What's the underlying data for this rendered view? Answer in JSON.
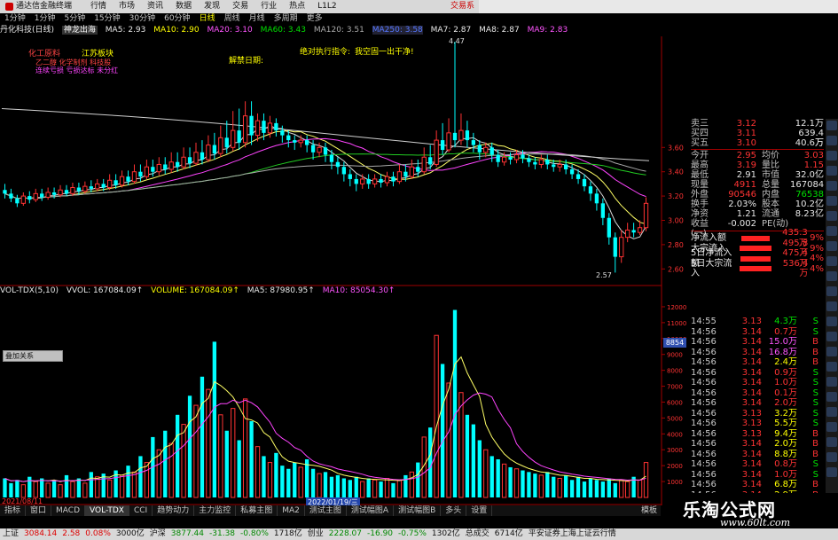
{
  "menubar": {
    "app_title": "通达信金融终端",
    "items": [
      "行情",
      "市场",
      "资讯",
      "数据",
      "发现",
      "交易",
      "行业",
      "热点",
      "L1L2"
    ],
    "trade_label": "交易系"
  },
  "toolbar": {
    "items": [
      "1分钟",
      "1分钟",
      "5分钟",
      "15分钟",
      "30分钟",
      "60分钟",
      "日线",
      "周线",
      "月线",
      "多周期",
      "更多"
    ],
    "active_index": 6
  },
  "ma_header": {
    "stock": "丹化科技(日线)",
    "indicator": "神龙出海",
    "ma5": "MA5: 2.93",
    "ma10": "MA10: 2.90",
    "ma20": "MA20: 3.10",
    "ma60": "MA60: 3.43",
    "ma120": "MA120: 3.51",
    "ma250": "MA250: 3.58",
    "ma7": "MA7: 2.87",
    "ma8": "MA8: 2.87",
    "ma9": "MA9: 2.83"
  },
  "annotations": {
    "a1": "化工原料",
    "a2": "江苏板块",
    "a3": "乙二醇 化学制剂 科技股",
    "a4": "连续亏损 亏损达标 未分红",
    "a5": "解禁日期:",
    "a6": "绝对执行指令:",
    "a7": "我空固一出干净!",
    "high_label": "4.47",
    "low_label": "2.57"
  },
  "colors": {
    "up": "#ff3333",
    "down": "#00ffff",
    "doji": "#ffff00",
    "ma_white": "#d8d8d8",
    "ma_yellow": "#ffff66",
    "ma_magenta": "#ff44ff",
    "ma_green": "#22cc22",
    "ma_gray": "#aaaaaa"
  },
  "price_axis": {
    "labels": [
      "3.60",
      "3.40",
      "3.20",
      "3.00",
      "2.80",
      "2.60"
    ],
    "ylim": [
      2.5,
      4.5
    ]
  },
  "volume_header": {
    "name": "VOL-TDX(5,10)",
    "vvol": "VVOL: 167084.09↑",
    "volume": "VOLUME: 167084.09↑",
    "ma5": "MA5: 87980.95↑",
    "ma10": "MA10: 85054.30↑"
  },
  "volume_axis": {
    "labels": [
      "12000",
      "11000",
      "10000",
      "9000",
      "8000",
      "7000",
      "6000",
      "5000",
      "4000",
      "3000",
      "2000",
      "1000"
    ],
    "marker": "8854"
  },
  "float_window": "叠加关系",
  "date_labels": {
    "left": "2021/08/11",
    "mid": "2022/01/19/三"
  },
  "bottom_tabs": {
    "items": [
      "指标",
      "窗口",
      "MACD",
      "VOL-TDX",
      "CCI",
      "趋势动力",
      "主力监控",
      "私募主图",
      "MA2",
      "测试主图",
      "测试幅图A",
      "测试幅图B",
      "多头",
      "设置"
    ],
    "active_index": 3,
    "right": "模板"
  },
  "quote_panel": {
    "top": [
      {
        "l": "卖三",
        "v": "3.12",
        "l2": "",
        "v2": "12.1万"
      },
      {
        "l": "买四",
        "v": "3.11",
        "l2": "",
        "v2": "639.4万"
      },
      {
        "l": "买五",
        "v": "3.10",
        "l2": "",
        "v2": "40.6万"
      }
    ],
    "rows": [
      {
        "l": "今开",
        "v": "2.95",
        "vc": "red",
        "l2": "均价",
        "v2": "3.03",
        "v2c": "red"
      },
      {
        "l": "最高",
        "v": "3.19",
        "vc": "red",
        "l2": "量比",
        "v2": "1.15",
        "v2c": "red"
      },
      {
        "l": "最低",
        "v": "2.91",
        "vc": "white",
        "l2": "市值",
        "v2": "32.0亿",
        "v2c": "white"
      },
      {
        "l": "现量",
        "v": "4911",
        "vc": "red",
        "l2": "总量",
        "v2": "167084",
        "v2c": "white"
      },
      {
        "l": "外盘",
        "v": "90546",
        "vc": "red",
        "l2": "内盘",
        "v2": "76538",
        "v2c": "green"
      },
      {
        "l": "换手",
        "v": "2.03%",
        "vc": "white",
        "l2": "股本",
        "v2": "10.2亿",
        "v2c": "white"
      },
      {
        "l": "净资",
        "v": "1.21",
        "vc": "white",
        "l2": "流通",
        "v2": "8.23亿",
        "v2c": "white"
      },
      {
        "l": "收益(一)",
        "v": "-0.002",
        "vc": "white",
        "l2": "PE(动)",
        "v2": "",
        "v2c": "white"
      }
    ],
    "flows": [
      {
        "l": "净流入额",
        "v": "435.3万",
        "p": "9%",
        "w": 36
      },
      {
        "l": "大宗流入",
        "v": "495.8万",
        "p": "9%",
        "w": 40
      },
      {
        "l": "5日净流入额",
        "v": "475.4万",
        "p": "4%",
        "w": 38
      },
      {
        "l": "5日大宗流入",
        "v": "536.4万",
        "p": "4%",
        "w": 42
      }
    ]
  },
  "ticks": [
    {
      "t": "14:55",
      "p": "3.13",
      "q": "4.3万",
      "qc": "green",
      "s": "S"
    },
    {
      "t": "14:56",
      "p": "3.14",
      "q": "0.7万",
      "qc": "red",
      "s": "S"
    },
    {
      "t": "14:56",
      "p": "3.14",
      "q": "15.0万",
      "qc": "mag",
      "s": "B"
    },
    {
      "t": "14:56",
      "p": "3.14",
      "q": "16.8万",
      "qc": "mag",
      "s": "B"
    },
    {
      "t": "14:56",
      "p": "3.14",
      "q": "2.4万",
      "qc": "yellow",
      "s": "B"
    },
    {
      "t": "14:56",
      "p": "3.14",
      "q": "0.9万",
      "qc": "red",
      "s": "S"
    },
    {
      "t": "14:56",
      "p": "3.14",
      "q": "1.0万",
      "qc": "red",
      "s": "S"
    },
    {
      "t": "14:56",
      "p": "3.14",
      "q": "0.1万",
      "qc": "red",
      "s": "S"
    },
    {
      "t": "14:56",
      "p": "3.14",
      "q": "2.0万",
      "qc": "red",
      "s": "S"
    },
    {
      "t": "14:56",
      "p": "3.13",
      "q": "3.2万",
      "qc": "yellow",
      "s": "S"
    },
    {
      "t": "14:56",
      "p": "3.13",
      "q": "5.5万",
      "qc": "yellow",
      "s": "S"
    },
    {
      "t": "14:56",
      "p": "3.13",
      "q": "9.4万",
      "qc": "yellow",
      "s": "B"
    },
    {
      "t": "14:56",
      "p": "3.14",
      "q": "2.0万",
      "qc": "yellow",
      "s": "B"
    },
    {
      "t": "14:56",
      "p": "3.14",
      "q": "8.8万",
      "qc": "yellow",
      "s": "B"
    },
    {
      "t": "14:56",
      "p": "3.14",
      "q": "0.8万",
      "qc": "red",
      "s": "S"
    },
    {
      "t": "14:56",
      "p": "3.14",
      "q": "1.0万",
      "qc": "red",
      "s": "S"
    },
    {
      "t": "14:56",
      "p": "3.14",
      "q": "6.8万",
      "qc": "yellow",
      "s": "B"
    },
    {
      "t": "14:56",
      "p": "3.14",
      "q": "2.9万",
      "qc": "yellow",
      "s": "B"
    },
    {
      "t": "14:56",
      "p": "3.14",
      "q": "1.7万",
      "qc": "yellow",
      "s": "B"
    }
  ],
  "statusbar": [
    {
      "t": "上证",
      "c": ""
    },
    {
      "t": "3084.14",
      "c": "red"
    },
    {
      "t": "2.58",
      "c": "red"
    },
    {
      "t": "0.08%",
      "c": "red"
    },
    {
      "t": "3000亿",
      "c": ""
    },
    {
      "t": "沪深",
      "c": ""
    },
    {
      "t": "3877.44",
      "c": "green"
    },
    {
      "t": "-31.38",
      "c": "green"
    },
    {
      "t": "-0.80%",
      "c": "green"
    },
    {
      "t": "1718亿",
      "c": ""
    },
    {
      "t": "创业",
      "c": ""
    },
    {
      "t": "2228.07",
      "c": "green"
    },
    {
      "t": "-16.90",
      "c": "green"
    },
    {
      "t": "-0.75%",
      "c": "green"
    },
    {
      "t": "1302亿",
      "c": ""
    },
    {
      "t": "总成交",
      "c": ""
    },
    {
      "t": "6714亿",
      "c": ""
    },
    {
      "t": "平安证券上海上证云行情",
      "c": ""
    }
  ],
  "watermark": {
    "title": "乐淘公式网",
    "url": "www.60lt.com"
  },
  "candles": [
    [
      3.25,
      3.22,
      3.3,
      3.18
    ],
    [
      3.22,
      3.18,
      3.26,
      3.15
    ],
    [
      3.18,
      3.14,
      3.21,
      3.11
    ],
    [
      3.14,
      3.2,
      3.23,
      3.12
    ],
    [
      3.2,
      3.17,
      3.24,
      3.14
    ],
    [
      3.17,
      3.22,
      3.26,
      3.15
    ],
    [
      3.22,
      3.19,
      3.26,
      3.16
    ],
    [
      3.19,
      3.23,
      3.27,
      3.17
    ],
    [
      3.23,
      3.21,
      3.27,
      3.18
    ],
    [
      3.21,
      3.25,
      3.29,
      3.19
    ],
    [
      3.25,
      3.22,
      3.29,
      3.2
    ],
    [
      3.22,
      3.27,
      3.31,
      3.2
    ],
    [
      3.27,
      3.24,
      3.31,
      3.21
    ],
    [
      3.24,
      3.28,
      3.32,
      3.22
    ],
    [
      3.28,
      3.26,
      3.33,
      3.23
    ],
    [
      3.26,
      3.3,
      3.34,
      3.24
    ],
    [
      3.3,
      3.27,
      3.34,
      3.24
    ],
    [
      3.27,
      3.33,
      3.38,
      3.25
    ],
    [
      3.33,
      3.29,
      3.38,
      3.26
    ],
    [
      3.29,
      3.36,
      3.41,
      3.27
    ],
    [
      3.36,
      3.32,
      3.41,
      3.29
    ],
    [
      3.32,
      3.4,
      3.46,
      3.3
    ],
    [
      3.4,
      3.36,
      3.46,
      3.32
    ],
    [
      3.36,
      3.44,
      3.5,
      3.34
    ],
    [
      3.44,
      3.4,
      3.5,
      3.36
    ],
    [
      3.4,
      3.46,
      3.52,
      3.37
    ],
    [
      3.46,
      3.42,
      3.52,
      3.38
    ],
    [
      3.42,
      3.48,
      3.56,
      3.39
    ],
    [
      3.48,
      3.44,
      3.56,
      3.4
    ],
    [
      3.44,
      3.52,
      3.6,
      3.42
    ],
    [
      3.52,
      3.47,
      3.6,
      3.43
    ],
    [
      3.47,
      3.56,
      3.64,
      3.45
    ],
    [
      3.56,
      3.5,
      3.66,
      3.46
    ],
    [
      3.5,
      3.62,
      3.7,
      3.48
    ],
    [
      3.62,
      3.55,
      3.72,
      3.5
    ],
    [
      3.55,
      3.68,
      3.78,
      3.52
    ],
    [
      3.68,
      3.6,
      3.82,
      3.55
    ],
    [
      3.6,
      3.74,
      3.9,
      3.57
    ],
    [
      3.74,
      3.64,
      3.92,
      3.58
    ],
    [
      3.64,
      3.86,
      3.98,
      3.6
    ],
    [
      3.86,
      3.7,
      3.98,
      3.62
    ],
    [
      3.7,
      3.82,
      3.88,
      3.65
    ],
    [
      3.82,
      3.72,
      3.88,
      3.66
    ],
    [
      3.72,
      3.8,
      3.86,
      3.68
    ],
    [
      3.8,
      3.74,
      3.84,
      3.69
    ],
    [
      3.74,
      3.7,
      3.78,
      3.64
    ],
    [
      3.7,
      3.66,
      3.74,
      3.6
    ],
    [
      3.66,
      3.64,
      3.7,
      3.58
    ],
    [
      3.64,
      3.66,
      3.7,
      3.6
    ],
    [
      3.66,
      3.62,
      3.7,
      3.56
    ],
    [
      3.62,
      3.56,
      3.66,
      3.5
    ],
    [
      3.56,
      3.6,
      3.64,
      3.52
    ],
    [
      3.6,
      3.54,
      3.64,
      3.48
    ],
    [
      3.54,
      3.48,
      3.58,
      3.42
    ],
    [
      3.48,
      3.44,
      3.52,
      3.38
    ],
    [
      3.44,
      3.38,
      3.48,
      3.32
    ],
    [
      3.38,
      3.34,
      3.42,
      3.28
    ],
    [
      3.34,
      3.3,
      3.38,
      3.24
    ],
    [
      3.3,
      3.34,
      3.38,
      3.26
    ],
    [
      3.34,
      3.3,
      3.38,
      3.26
    ],
    [
      3.3,
      3.34,
      3.38,
      3.27
    ],
    [
      3.34,
      3.31,
      3.38,
      3.27
    ],
    [
      3.31,
      3.36,
      3.4,
      3.28
    ],
    [
      3.36,
      3.32,
      3.4,
      3.28
    ],
    [
      3.32,
      3.4,
      3.46,
      3.3
    ],
    [
      3.4,
      3.36,
      3.46,
      3.32
    ],
    [
      3.36,
      3.44,
      3.5,
      3.34
    ],
    [
      3.44,
      3.4,
      3.5,
      3.36
    ],
    [
      3.4,
      3.52,
      3.6,
      3.38
    ],
    [
      3.52,
      3.46,
      3.62,
      3.42
    ],
    [
      3.46,
      3.66,
      3.74,
      3.44
    ],
    [
      3.66,
      3.58,
      3.8,
      3.54
    ],
    [
      3.58,
      3.72,
      3.84,
      3.56
    ],
    [
      3.72,
      3.66,
      4.47,
      3.6
    ],
    [
      3.66,
      3.74,
      3.88,
      3.62
    ],
    [
      3.74,
      3.66,
      3.82,
      3.6
    ],
    [
      3.66,
      3.62,
      3.72,
      3.56
    ],
    [
      3.62,
      3.56,
      3.66,
      3.5
    ],
    [
      3.56,
      3.6,
      3.64,
      3.52
    ],
    [
      3.6,
      3.54,
      3.64,
      3.48
    ],
    [
      3.54,
      3.48,
      3.58,
      3.44
    ],
    [
      3.48,
      3.52,
      3.56,
      3.45
    ],
    [
      3.52,
      3.5,
      3.56,
      3.46
    ],
    [
      3.5,
      3.54,
      3.58,
      3.47
    ],
    [
      3.54,
      3.51,
      3.58,
      3.47
    ],
    [
      3.51,
      3.48,
      3.54,
      3.44
    ],
    [
      3.48,
      3.46,
      3.52,
      3.42
    ],
    [
      3.46,
      3.5,
      3.54,
      3.43
    ],
    [
      3.5,
      3.46,
      3.54,
      3.42
    ],
    [
      3.46,
      3.44,
      3.5,
      3.4
    ],
    [
      3.44,
      3.46,
      3.5,
      3.4
    ],
    [
      3.46,
      3.42,
      3.5,
      3.38
    ],
    [
      3.42,
      3.38,
      3.46,
      3.34
    ],
    [
      3.38,
      3.34,
      3.42,
      3.3
    ],
    [
      3.34,
      3.28,
      3.38,
      3.24
    ],
    [
      3.28,
      3.22,
      3.32,
      3.16
    ],
    [
      3.22,
      3.14,
      3.26,
      3.08
    ],
    [
      3.14,
      3.02,
      3.18,
      2.96
    ],
    [
      3.02,
      2.86,
      3.06,
      2.8
    ],
    [
      2.86,
      2.7,
      2.9,
      2.57
    ],
    [
      2.7,
      2.86,
      2.92,
      2.65
    ],
    [
      2.86,
      2.92,
      2.98,
      2.82
    ],
    [
      2.92,
      2.9,
      2.98,
      2.86
    ],
    [
      2.9,
      2.94,
      3.0,
      2.88
    ],
    [
      2.94,
      3.14,
      3.19,
      2.91
    ]
  ],
  "volumes": [
    1200,
    900,
    1100,
    800,
    1300,
    1000,
    1200,
    900,
    1100,
    800,
    1400,
    1000,
    1200,
    900,
    1600,
    1300,
    1500,
    1100,
    1700,
    1400,
    2000,
    1600,
    2600,
    2200,
    3800,
    3000,
    4200,
    3400,
    5200,
    4600,
    6400,
    5800,
    7600,
    6800,
    9800,
    5200,
    4200,
    5600,
    3600,
    6200,
    4800,
    3200,
    2600,
    2200,
    2800,
    2000,
    1800,
    2200,
    1900,
    2400,
    1800,
    1500,
    1600,
    1300,
    1400,
    1200,
    1100,
    1300,
    1000,
    1200,
    1100,
    1000,
    1200,
    900,
    1100,
    1400,
    1600,
    2200,
    3800,
    4400,
    10200,
    8400,
    7200,
    11800,
    6600,
    5200,
    4600,
    3600,
    3000,
    2600,
    2400,
    2100,
    1900,
    1800,
    1700,
    1600,
    1500,
    1400,
    1600,
    1300,
    1200,
    1400,
    1100,
    1300,
    1000,
    1200,
    1100,
    1000,
    1200,
    900,
    1100,
    1000,
    1300,
    1100,
    2200
  ],
  "volume_ylim": [
    0,
    12500
  ],
  "chart_data": {
    "type": "candlestick",
    "high_label": "4.47",
    "low_label": "2.57"
  }
}
